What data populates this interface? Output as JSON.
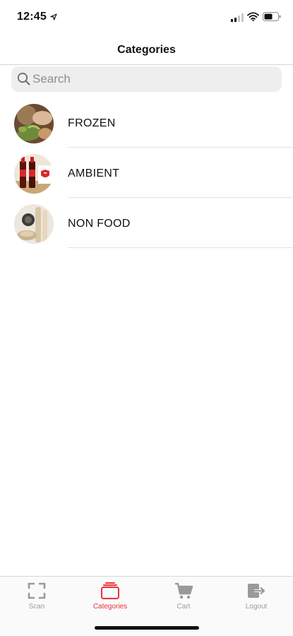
{
  "status_bar": {
    "time": "12:45",
    "icons": [
      "location-arrow-icon",
      "cellular-signal-icon",
      "wifi-icon",
      "battery-icon"
    ]
  },
  "nav": {
    "title": "Categories"
  },
  "search": {
    "placeholder": "Search",
    "value": ""
  },
  "categories": [
    {
      "label": "FROZEN",
      "image": "frozen-food-thumbnail"
    },
    {
      "label": "AMBIENT",
      "image": "sauce-bottles-thumbnail"
    },
    {
      "label": "NON FOOD",
      "image": "household-items-thumbnail"
    }
  ],
  "tabs": [
    {
      "label": "Scan",
      "icon": "scan-icon",
      "active": false
    },
    {
      "label": "Categories",
      "icon": "categories-icon",
      "active": true
    },
    {
      "label": "Cart",
      "icon": "cart-icon",
      "active": false
    },
    {
      "label": "Logout",
      "icon": "logout-icon",
      "active": false
    }
  ],
  "colors": {
    "accent": "#e8323a",
    "inactive": "#9a9a9a",
    "search_bg": "#eeeeef",
    "divider": "#e3e3e3"
  }
}
